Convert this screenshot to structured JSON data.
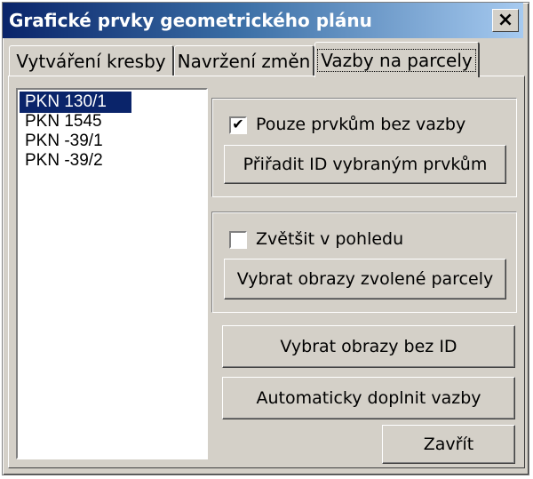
{
  "window": {
    "title": "Grafické prvky geometrického plánu",
    "close_symbol": "×"
  },
  "tabs": [
    {
      "label": "Vytváření kresby",
      "active": false
    },
    {
      "label": "Navržení změn",
      "active": false
    },
    {
      "label": "Vazby na parcely",
      "active": true
    }
  ],
  "parcels": {
    "items": [
      "PKN 130/1",
      "PKN 1545",
      "PKN -39/1",
      "PKN -39/2"
    ],
    "selected_index": 0
  },
  "group1": {
    "checkbox_label": "Pouze prvkům bez vazby",
    "checked": true,
    "check_mark": "✔",
    "button_label": "Přiřadit ID vybraným prvkům"
  },
  "group2": {
    "checkbox_label": "Zvětšit v pohledu",
    "checked": false,
    "button_label": "Vybrat obrazy zvolené parcely"
  },
  "buttons": {
    "select_without_id": "Vybrat obrazy bez ID",
    "auto_fill": "Automaticky doplnit vazby",
    "close": "Zavřít"
  },
  "colors": {
    "title_bar": "#0a246a",
    "face": "#d4d0c8",
    "selection": "#0a246a"
  }
}
